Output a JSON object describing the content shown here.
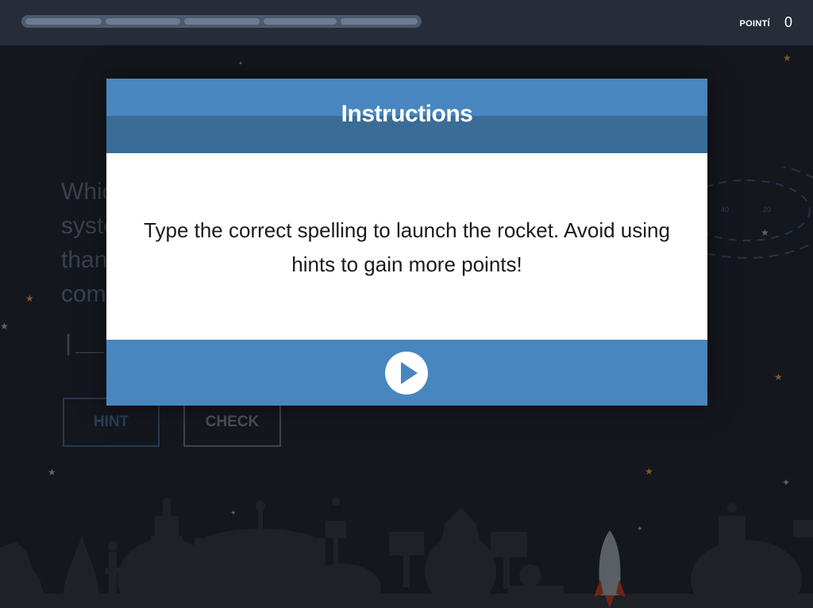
{
  "topbar": {
    "progress_segments": 5,
    "points_label": "POINTÍ",
    "points_value": "0"
  },
  "background_game": {
    "question_text": "Whic\nsyste\nthan\ncom",
    "blanks_text": "|__",
    "hint_label": "HINT",
    "check_label": "CHECK",
    "radar_labels": [
      "40",
      "20"
    ]
  },
  "modal": {
    "title": "Instructions",
    "body": "Type the correct spelling to launch the rocket. Avoid using hints to gain more points!",
    "play_icon": "play-icon"
  },
  "colors": {
    "topbar_bg": "#272d38",
    "scene_bg": "#14171d",
    "modal_header": "#4886bf",
    "modal_header_dark": "#3a6c98",
    "modal_footer": "#4886bf",
    "hint_border": "#243b53",
    "check_border": "#3e444e"
  }
}
